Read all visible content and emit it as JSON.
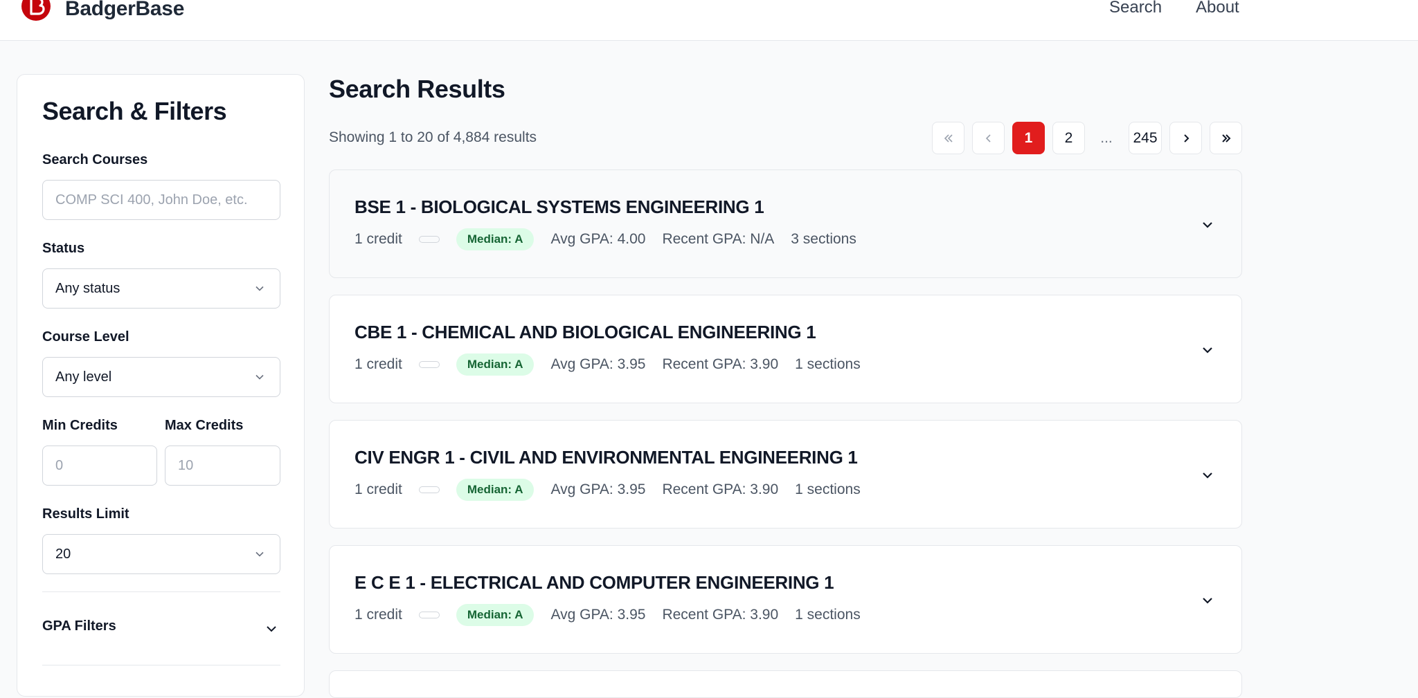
{
  "header": {
    "brand": "BadgerBase",
    "nav": [
      {
        "label": "Search"
      },
      {
        "label": "About"
      }
    ],
    "accent": "#c5050c"
  },
  "sidebar": {
    "title": "Search & Filters",
    "search": {
      "label": "Search Courses",
      "placeholder": "COMP SCI 400, John Doe, etc.",
      "value": ""
    },
    "status": {
      "label": "Status",
      "value": "Any status"
    },
    "level": {
      "label": "Course Level",
      "value": "Any level"
    },
    "min_credits": {
      "label": "Min Credits",
      "placeholder": "0"
    },
    "max_credits": {
      "label": "Max Credits",
      "placeholder": "10"
    },
    "limit": {
      "label": "Results Limit",
      "value": "20"
    },
    "gpa_filters": {
      "label": "GPA Filters"
    }
  },
  "main": {
    "title": "Search Results",
    "showing": "Showing 1 to 20 of 4,884 results",
    "pagination": {
      "current": "1",
      "next": "2",
      "ellipsis": "...",
      "last": "245"
    },
    "courses": [
      {
        "title": "BSE 1 - BIOLOGICAL SYSTEMS ENGINEERING 1",
        "credits": "1 credit",
        "median": "Median: A",
        "avg_gpa": "Avg GPA: 4.00",
        "recent_gpa": "Recent GPA: N/A",
        "sections": "3 sections"
      },
      {
        "title": "CBE 1 - CHEMICAL AND BIOLOGICAL ENGINEERING 1",
        "credits": "1 credit",
        "median": "Median: A",
        "avg_gpa": "Avg GPA: 3.95",
        "recent_gpa": "Recent GPA: 3.90",
        "sections": "1 sections"
      },
      {
        "title": "CIV ENGR 1 - CIVIL AND ENVIRONMENTAL ENGINEERING 1",
        "credits": "1 credit",
        "median": "Median: A",
        "avg_gpa": "Avg GPA: 3.95",
        "recent_gpa": "Recent GPA: 3.90",
        "sections": "1 sections"
      },
      {
        "title": "E C E 1 - ELECTRICAL AND COMPUTER ENGINEERING 1",
        "credits": "1 credit",
        "median": "Median: A",
        "avg_gpa": "Avg GPA: 3.95",
        "recent_gpa": "Recent GPA: 3.90",
        "sections": "1 sections"
      }
    ],
    "icons": {
      "expand": "chevron-down-icon",
      "first": "double-chevron-left-icon",
      "prev": "chevron-left-icon",
      "next": "chevron-right-icon",
      "last": "double-chevron-right-icon"
    },
    "colors": {
      "active_page": "#e11d1d",
      "median_badge_bg": "#dcfce7",
      "median_badge_text": "#166534"
    }
  }
}
